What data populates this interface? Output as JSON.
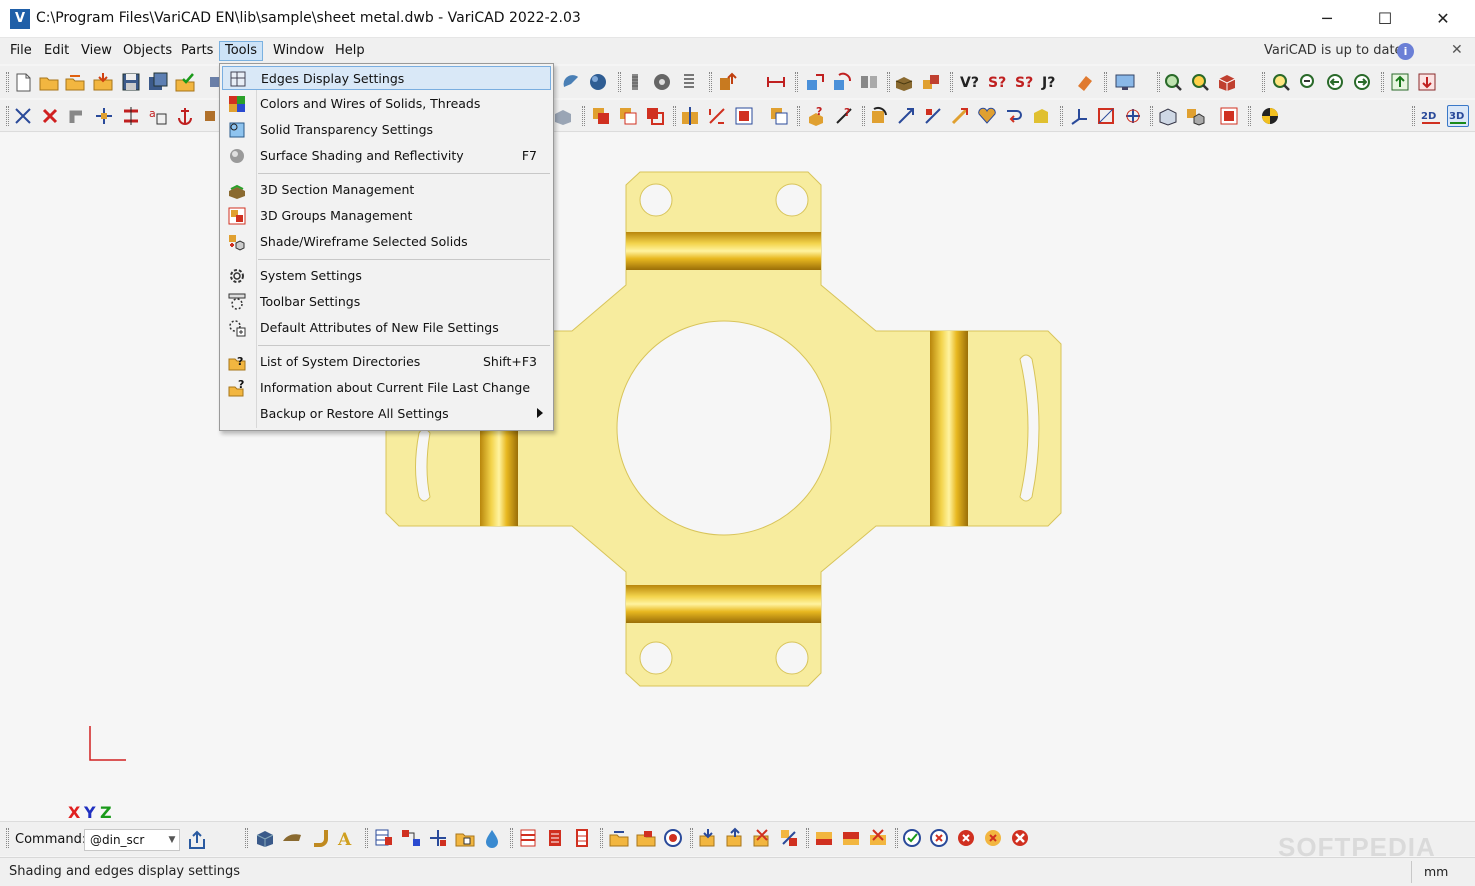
{
  "window": {
    "title": "C:\\Program Files\\VariCAD EN\\lib\\sample\\sheet metal.dwb - VariCAD 2022-2.03",
    "logo_letter": "V",
    "minimize_glyph": "─",
    "maximize_glyph": "☐",
    "close_glyph": "✕"
  },
  "menubar": {
    "items": [
      {
        "label": "File"
      },
      {
        "label": "Edit"
      },
      {
        "label": "View"
      },
      {
        "label": "Objects"
      },
      {
        "label": "Parts"
      },
      {
        "label": "Tools",
        "active": true
      },
      {
        "label": "Window"
      },
      {
        "label": "Help"
      }
    ],
    "update_status": "VariCAD is up to date",
    "info_glyph": "i",
    "dismiss_glyph": "✕"
  },
  "tools_menu": {
    "items": [
      {
        "label": "Edges Display Settings",
        "icon": "edges-display-icon",
        "highlighted": true
      },
      {
        "label": "Colors and Wires of Solids, Threads",
        "icon": "colors-wires-icon"
      },
      {
        "label": "Solid Transparency Settings",
        "icon": "transparency-icon"
      },
      {
        "label": "Surface Shading and Reflectivity",
        "shortcut": "F7",
        "icon": "shading-sphere-icon"
      },
      {
        "label": "3D Section Management",
        "icon": "section-management-icon"
      },
      {
        "label": "3D Groups Management",
        "icon": "groups-management-icon"
      },
      {
        "label": "Shade/Wireframe Selected Solids",
        "icon": "shade-wireframe-icon"
      },
      {
        "label": "System Settings",
        "icon": "system-settings-gear-icon"
      },
      {
        "label": "Toolbar Settings",
        "icon": "toolbar-settings-icon"
      },
      {
        "label": "Default Attributes of New File Settings",
        "icon": "default-attributes-icon"
      },
      {
        "label": "List of System Directories",
        "shortcut": "Shift+F3",
        "icon": "directories-question-icon"
      },
      {
        "label": "Information about Current File Last Change",
        "icon": "file-info-question-icon"
      },
      {
        "label": "Backup or Restore All Settings",
        "submenu": true,
        "icon": "backup-restore-icon"
      }
    ]
  },
  "viewport": {
    "axis_labels": {
      "x": "X",
      "y": "Y",
      "z": "Z"
    },
    "part_fill": "#f7ec9e",
    "part_stroke": "#d8c45a"
  },
  "command": {
    "label": "Command:",
    "value": "@din_scr"
  },
  "status": {
    "message": "Shading and edges display settings",
    "unit": "mm"
  },
  "watermark": "SOFTPEDIA",
  "colors": {
    "accent": "#3a78c8",
    "menu_highlight": "#d9e8f7",
    "part_yellow": "#f7ec9e",
    "bend_gold": "#e0b020",
    "axis_x": "#e02020",
    "axis_y": "#2030c0",
    "axis_z": "#1a9a1a"
  }
}
